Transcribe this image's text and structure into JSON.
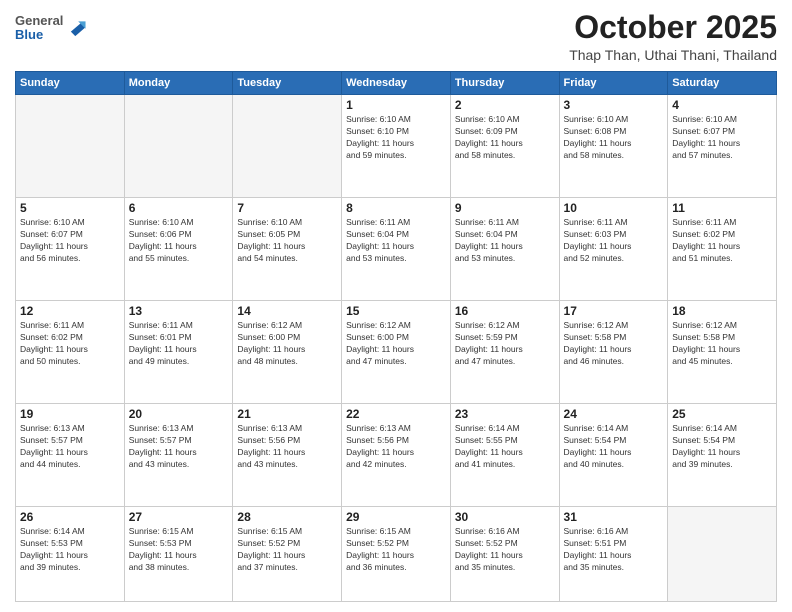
{
  "header": {
    "logo": {
      "general": "General",
      "blue": "Blue"
    },
    "month": "October 2025",
    "location": "Thap Than, Uthai Thani, Thailand"
  },
  "weekdays": [
    "Sunday",
    "Monday",
    "Tuesday",
    "Wednesday",
    "Thursday",
    "Friday",
    "Saturday"
  ],
  "weeks": [
    [
      {
        "day": "",
        "info": ""
      },
      {
        "day": "",
        "info": ""
      },
      {
        "day": "",
        "info": ""
      },
      {
        "day": "1",
        "info": "Sunrise: 6:10 AM\nSunset: 6:10 PM\nDaylight: 11 hours\nand 59 minutes."
      },
      {
        "day": "2",
        "info": "Sunrise: 6:10 AM\nSunset: 6:09 PM\nDaylight: 11 hours\nand 58 minutes."
      },
      {
        "day": "3",
        "info": "Sunrise: 6:10 AM\nSunset: 6:08 PM\nDaylight: 11 hours\nand 58 minutes."
      },
      {
        "day": "4",
        "info": "Sunrise: 6:10 AM\nSunset: 6:07 PM\nDaylight: 11 hours\nand 57 minutes."
      }
    ],
    [
      {
        "day": "5",
        "info": "Sunrise: 6:10 AM\nSunset: 6:07 PM\nDaylight: 11 hours\nand 56 minutes."
      },
      {
        "day": "6",
        "info": "Sunrise: 6:10 AM\nSunset: 6:06 PM\nDaylight: 11 hours\nand 55 minutes."
      },
      {
        "day": "7",
        "info": "Sunrise: 6:10 AM\nSunset: 6:05 PM\nDaylight: 11 hours\nand 54 minutes."
      },
      {
        "day": "8",
        "info": "Sunrise: 6:11 AM\nSunset: 6:04 PM\nDaylight: 11 hours\nand 53 minutes."
      },
      {
        "day": "9",
        "info": "Sunrise: 6:11 AM\nSunset: 6:04 PM\nDaylight: 11 hours\nand 53 minutes."
      },
      {
        "day": "10",
        "info": "Sunrise: 6:11 AM\nSunset: 6:03 PM\nDaylight: 11 hours\nand 52 minutes."
      },
      {
        "day": "11",
        "info": "Sunrise: 6:11 AM\nSunset: 6:02 PM\nDaylight: 11 hours\nand 51 minutes."
      }
    ],
    [
      {
        "day": "12",
        "info": "Sunrise: 6:11 AM\nSunset: 6:02 PM\nDaylight: 11 hours\nand 50 minutes."
      },
      {
        "day": "13",
        "info": "Sunrise: 6:11 AM\nSunset: 6:01 PM\nDaylight: 11 hours\nand 49 minutes."
      },
      {
        "day": "14",
        "info": "Sunrise: 6:12 AM\nSunset: 6:00 PM\nDaylight: 11 hours\nand 48 minutes."
      },
      {
        "day": "15",
        "info": "Sunrise: 6:12 AM\nSunset: 6:00 PM\nDaylight: 11 hours\nand 47 minutes."
      },
      {
        "day": "16",
        "info": "Sunrise: 6:12 AM\nSunset: 5:59 PM\nDaylight: 11 hours\nand 47 minutes."
      },
      {
        "day": "17",
        "info": "Sunrise: 6:12 AM\nSunset: 5:58 PM\nDaylight: 11 hours\nand 46 minutes."
      },
      {
        "day": "18",
        "info": "Sunrise: 6:12 AM\nSunset: 5:58 PM\nDaylight: 11 hours\nand 45 minutes."
      }
    ],
    [
      {
        "day": "19",
        "info": "Sunrise: 6:13 AM\nSunset: 5:57 PM\nDaylight: 11 hours\nand 44 minutes."
      },
      {
        "day": "20",
        "info": "Sunrise: 6:13 AM\nSunset: 5:57 PM\nDaylight: 11 hours\nand 43 minutes."
      },
      {
        "day": "21",
        "info": "Sunrise: 6:13 AM\nSunset: 5:56 PM\nDaylight: 11 hours\nand 43 minutes."
      },
      {
        "day": "22",
        "info": "Sunrise: 6:13 AM\nSunset: 5:56 PM\nDaylight: 11 hours\nand 42 minutes."
      },
      {
        "day": "23",
        "info": "Sunrise: 6:14 AM\nSunset: 5:55 PM\nDaylight: 11 hours\nand 41 minutes."
      },
      {
        "day": "24",
        "info": "Sunrise: 6:14 AM\nSunset: 5:54 PM\nDaylight: 11 hours\nand 40 minutes."
      },
      {
        "day": "25",
        "info": "Sunrise: 6:14 AM\nSunset: 5:54 PM\nDaylight: 11 hours\nand 39 minutes."
      }
    ],
    [
      {
        "day": "26",
        "info": "Sunrise: 6:14 AM\nSunset: 5:53 PM\nDaylight: 11 hours\nand 39 minutes."
      },
      {
        "day": "27",
        "info": "Sunrise: 6:15 AM\nSunset: 5:53 PM\nDaylight: 11 hours\nand 38 minutes."
      },
      {
        "day": "28",
        "info": "Sunrise: 6:15 AM\nSunset: 5:52 PM\nDaylight: 11 hours\nand 37 minutes."
      },
      {
        "day": "29",
        "info": "Sunrise: 6:15 AM\nSunset: 5:52 PM\nDaylight: 11 hours\nand 36 minutes."
      },
      {
        "day": "30",
        "info": "Sunrise: 6:16 AM\nSunset: 5:52 PM\nDaylight: 11 hours\nand 35 minutes."
      },
      {
        "day": "31",
        "info": "Sunrise: 6:16 AM\nSunset: 5:51 PM\nDaylight: 11 hours\nand 35 minutes."
      },
      {
        "day": "",
        "info": ""
      }
    ]
  ]
}
